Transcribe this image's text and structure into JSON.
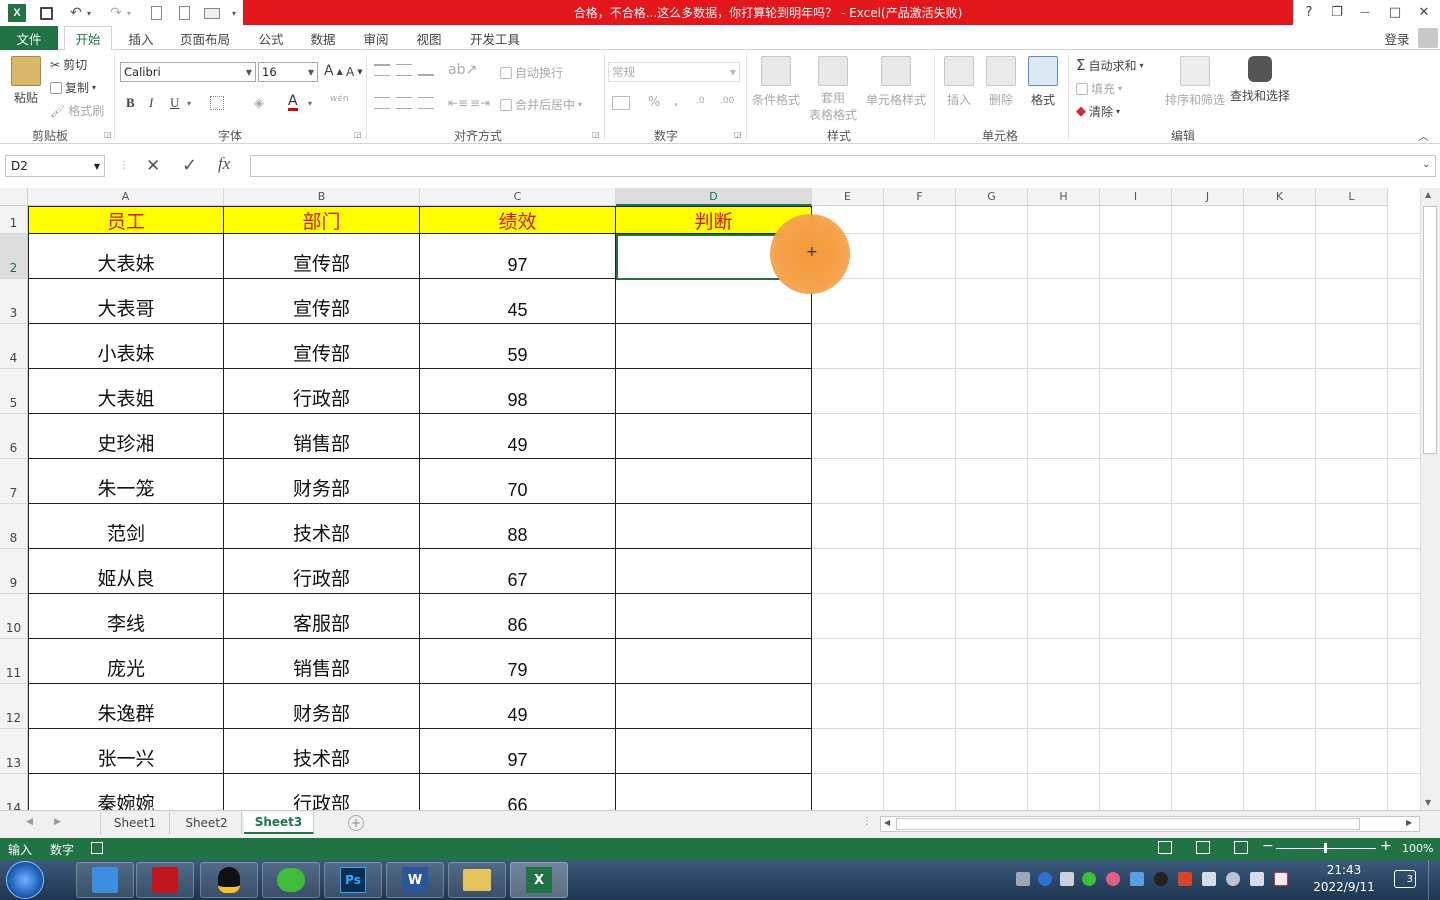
{
  "window": {
    "title": "合格，不合格...这么多数据，你打算轮到明年吗？ - Excel(产品激活失败)",
    "help": "?",
    "restore": "❐",
    "minimize": "—",
    "maximize": "□",
    "close": "✕"
  },
  "quick_access": [
    "save-icon",
    "undo-icon",
    "redo-icon",
    "print-preview-icon",
    "new-icon",
    "open-icon"
  ],
  "menu": {
    "file": "文件",
    "tabs": [
      "开始",
      "插入",
      "页面布局",
      "公式",
      "数据",
      "审阅",
      "视图",
      "开发工具"
    ],
    "login": "登录"
  },
  "ribbon": {
    "clipboard": {
      "label": "剪贴板",
      "paste": "粘贴",
      "cut": "剪切",
      "copy": "复制",
      "format_painter": "格式刷"
    },
    "font": {
      "label": "字体",
      "name": "Calibri",
      "size": "16",
      "bold": "B",
      "italic": "I",
      "underline": "U",
      "grow": "A",
      "shrink": "A",
      "font_color": "A",
      "phonetic": "wén"
    },
    "alignment": {
      "label": "对齐方式",
      "wrap": "自动换行",
      "merge": "合并后居中"
    },
    "number": {
      "label": "数字",
      "format": "常规",
      "percent": "%",
      "comma": ",",
      "inc_dec": ".0",
      "dec_dec": ".00"
    },
    "styles": {
      "label": "样式",
      "conditional": "条件格式",
      "table_fmt_1": "套用",
      "table_fmt_2": "表格格式",
      "cell_styles": "单元格样式"
    },
    "cells": {
      "label": "单元格",
      "insert": "插入",
      "delete": "删除",
      "format": "格式"
    },
    "editing": {
      "label": "编辑",
      "autosum": "自动求和",
      "fill": "填充",
      "clear": "清除",
      "sort": "排序和筛选",
      "find": "查找和选择"
    }
  },
  "formula_bar": {
    "name_box": "D2",
    "cancel": "✕",
    "enter": "✓",
    "fx": "fx",
    "value": ""
  },
  "columns": [
    "A",
    "B",
    "C",
    "D",
    "E",
    "F",
    "G",
    "H",
    "I",
    "J",
    "K",
    "L"
  ],
  "headers": [
    "员工",
    "部门",
    "绩效",
    "判断"
  ],
  "rows": [
    {
      "n": "1"
    },
    {
      "n": "2",
      "name": "大表妹",
      "dept": "宣传部",
      "score": "97"
    },
    {
      "n": "3",
      "name": "大表哥",
      "dept": "宣传部",
      "score": "45"
    },
    {
      "n": "4",
      "name": "小表妹",
      "dept": "宣传部",
      "score": "59"
    },
    {
      "n": "5",
      "name": "大表姐",
      "dept": "行政部",
      "score": "98"
    },
    {
      "n": "6",
      "name": "史珍湘",
      "dept": "销售部",
      "score": "49"
    },
    {
      "n": "7",
      "name": "朱一笼",
      "dept": "财务部",
      "score": "70"
    },
    {
      "n": "8",
      "name": "范剑",
      "dept": "技术部",
      "score": "88"
    },
    {
      "n": "9",
      "name": "姬从良",
      "dept": "行政部",
      "score": "67"
    },
    {
      "n": "10",
      "name": "李线",
      "dept": "客服部",
      "score": "86"
    },
    {
      "n": "11",
      "name": "庞光",
      "dept": "销售部",
      "score": "79"
    },
    {
      "n": "12",
      "name": "朱逸群",
      "dept": "财务部",
      "score": "49"
    },
    {
      "n": "13",
      "name": "张一兴",
      "dept": "技术部",
      "score": "97"
    },
    {
      "n": "14",
      "name": "秦婉婉",
      "dept": "行政部",
      "score": "66"
    }
  ],
  "sheets": [
    "Sheet1",
    "Sheet2",
    "Sheet3"
  ],
  "status": {
    "mode": "输入",
    "num": "数字",
    "zoom": "100%"
  },
  "clock": {
    "time": "21:43",
    "date": "2022/9/11",
    "notif": "3"
  },
  "colors": {
    "excel_green": "#217346",
    "title_red": "#e3161b",
    "header_yellow": "#ffff00",
    "header_text": "#d6141a"
  }
}
